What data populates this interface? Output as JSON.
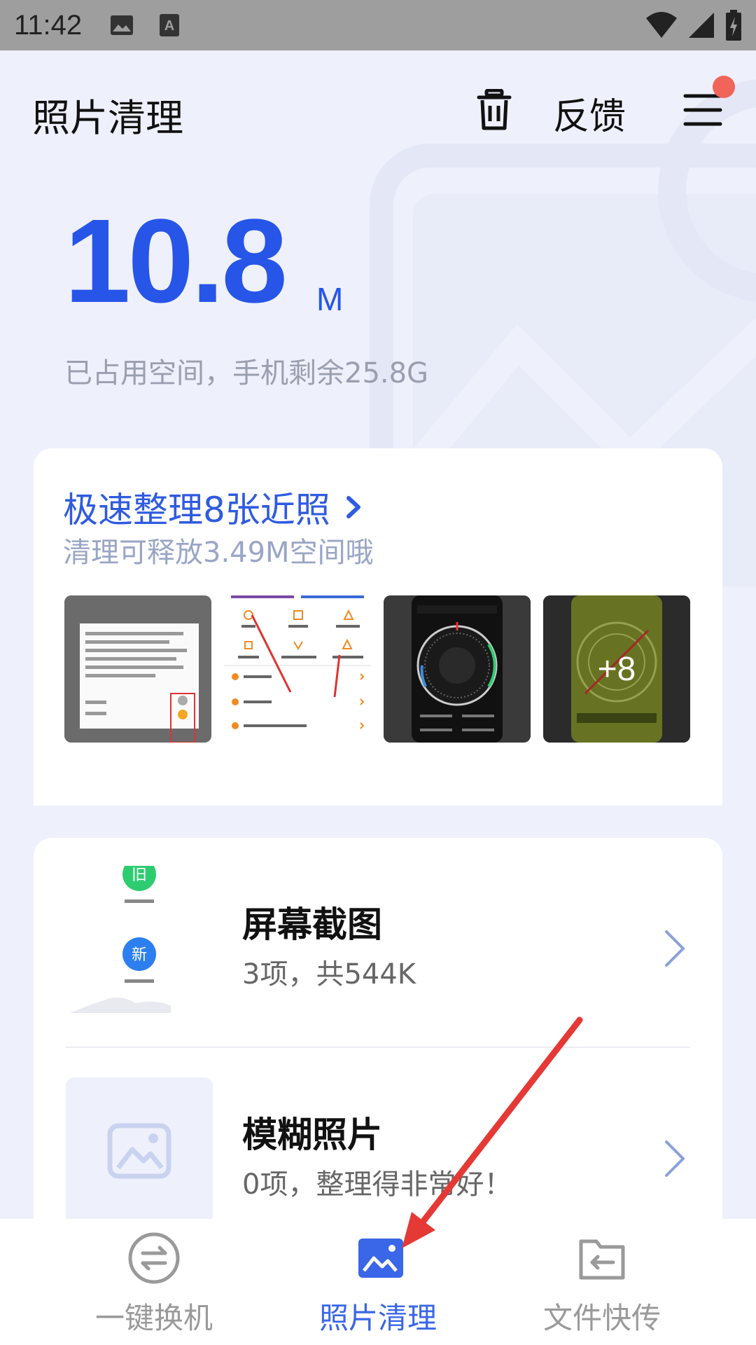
{
  "status_bar": {
    "time": "11:42",
    "icons": [
      "image-notification-icon",
      "text-notification-icon",
      "wifi-icon",
      "signal-icon",
      "battery-charging-icon"
    ]
  },
  "header": {
    "title": "照片清理",
    "feedback_label": "反馈"
  },
  "storage": {
    "value": "10.8",
    "unit": "M",
    "description": "已占用空间，手机剩余25.8G"
  },
  "quick_clean": {
    "title": "极速整理8张近照",
    "subtitle": "清理可释放3.49M空间哦",
    "more_count": "+8"
  },
  "list": [
    {
      "title": "屏幕截图",
      "subtitle": "3项，共544K"
    },
    {
      "title": "模糊照片",
      "subtitle": "0项，整理得非常好！"
    }
  ],
  "bottom_nav": [
    {
      "label": "一键换机",
      "active": false
    },
    {
      "label": "照片清理",
      "active": true
    },
    {
      "label": "文件快传",
      "active": false
    }
  ],
  "colors": {
    "accent": "#2655e8",
    "nav_active": "#3a66e8",
    "nav_inactive": "#9a9a9a",
    "annotation": "#e53935",
    "badge": "#f0645a"
  }
}
